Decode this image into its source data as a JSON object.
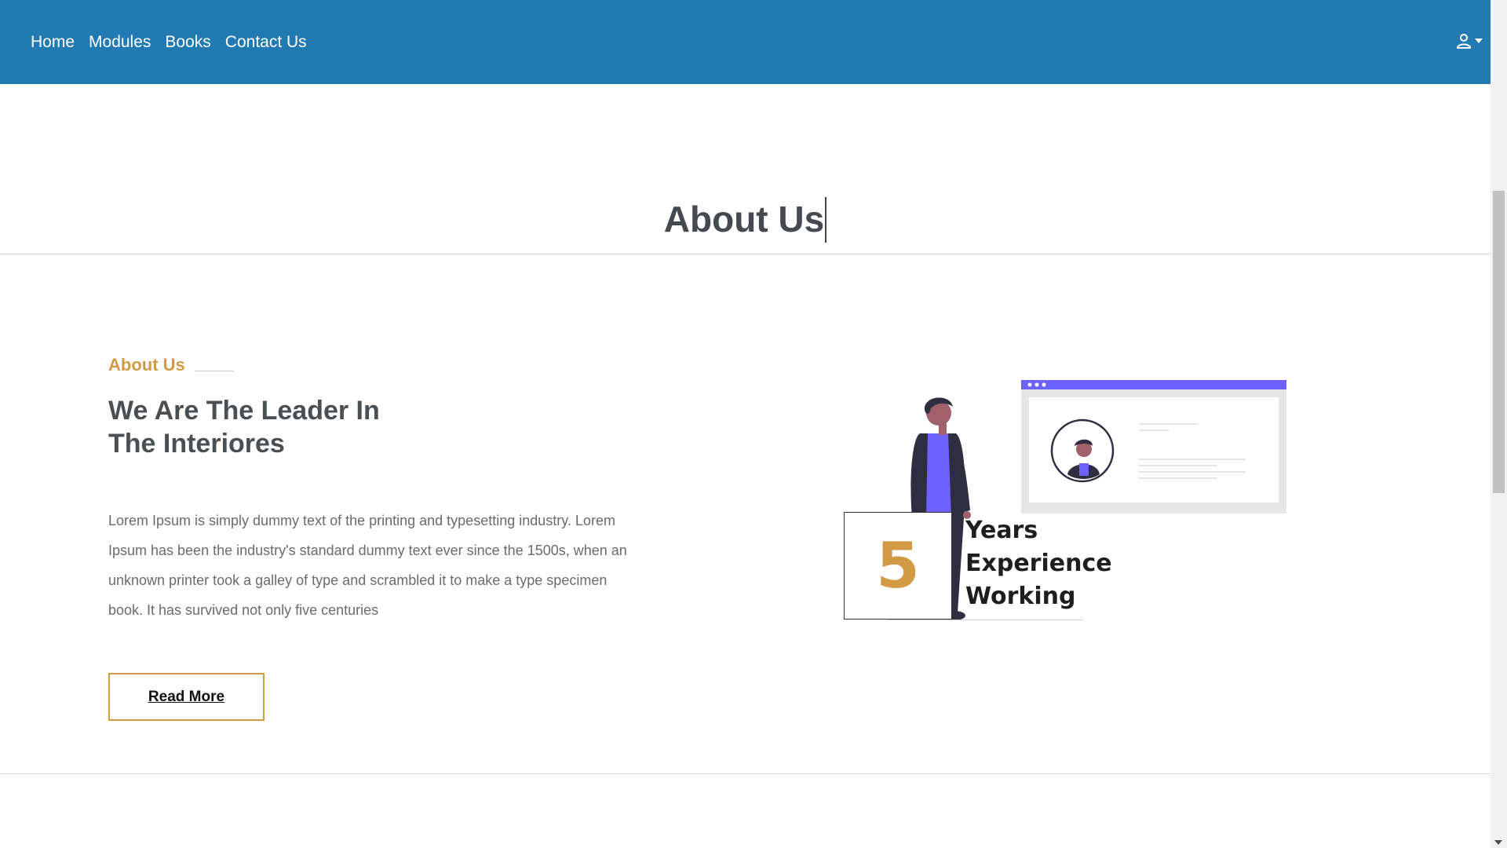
{
  "nav": {
    "links": [
      "Home",
      "Modules",
      "Books",
      "Contact Us"
    ],
    "user_icon": "user-icon",
    "caret_icon": "caret-down-icon"
  },
  "page": {
    "title": "About Us"
  },
  "about": {
    "eyebrow": "About Us",
    "headline_line1": "We Are The Leader In",
    "headline_line2": "The Interiores",
    "body": "Lorem Ipsum is simply dummy text of the printing and typesetting industry. Lorem Ipsum has been the industry's standard dummy text ever since the 1500s, when an unknown printer took a galley of type and scrambled it to make a type specimen book. It has survived not only five centuries",
    "read_more": "Read More"
  },
  "experience": {
    "number": "5",
    "line1": "Years",
    "line2": "Experience",
    "line3": "Working"
  },
  "colors": {
    "navbar": "#227ab3",
    "accent": "#d29a44",
    "illustration_purple": "#6c63ff"
  }
}
